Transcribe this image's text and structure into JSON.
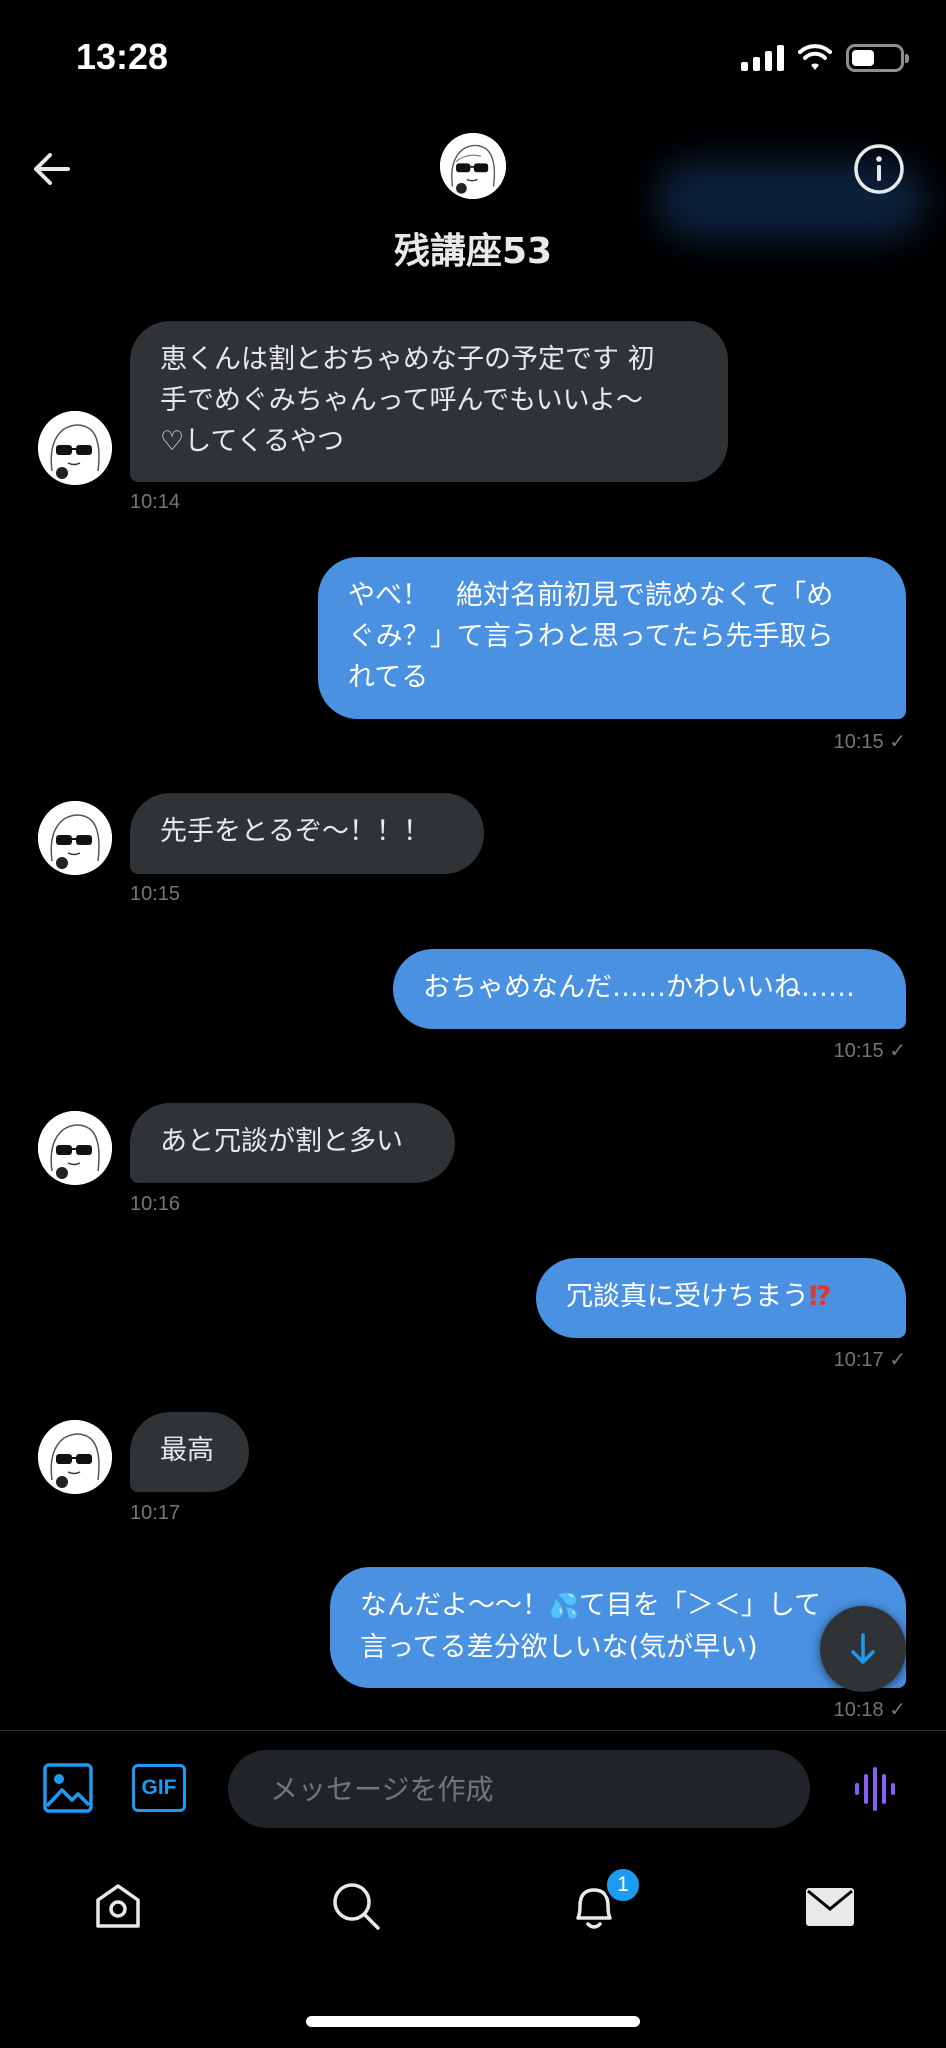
{
  "status_bar": {
    "time": "13:28"
  },
  "header": {
    "name": "残講座53"
  },
  "messages": [
    {
      "text": "恵くんは割とおちゃめな子の予定です 初\n手でめぐみちゃんって呼んでもいいよ〜\n♡してくるやつ",
      "time": "10:14"
    },
    {
      "text": "やべ！　絶対名前初見で読めなくて「め\nぐみ？」て言うわと思ってたら先手取ら\nれてる",
      "time": "10:15",
      "status": "✓"
    },
    {
      "text": "先手をとるぞ〜！！！",
      "time": "10:15"
    },
    {
      "text": "おちゃめなんだ……かわいいね……",
      "time": "10:15",
      "status": "✓"
    },
    {
      "text": "あと冗談が割と多い",
      "time": "10:16"
    },
    {
      "text": "冗談真に受けちまう",
      "emoji": "⁉",
      "time": "10:17",
      "status": "✓"
    },
    {
      "text": "最高",
      "time": "10:17"
    },
    {
      "text_a": "なんだよ〜〜！",
      "emoji": "💦",
      "text_b": "て目を「＞＜」して\n言ってる差分欲しいな(気が早い)",
      "time": "10:18",
      "status": "✓"
    }
  ],
  "composer": {
    "gif_label": "GIF",
    "placeholder": "メッセージを作成"
  },
  "tabbar": {
    "notification_count": "1"
  },
  "colors": {
    "outgoing_bubble": "#4a91e2",
    "incoming_bubble": "#2f3336",
    "accent": "#1d9bf0",
    "voice": "#8b5cf6"
  }
}
